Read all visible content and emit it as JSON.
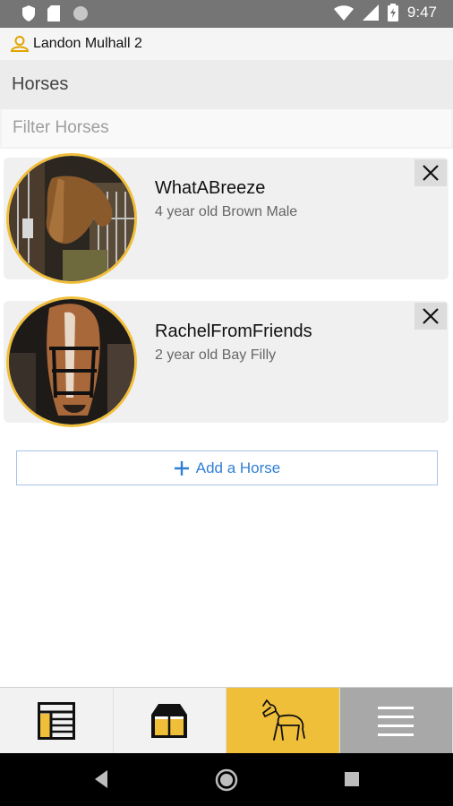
{
  "status_bar": {
    "time": "9:47",
    "icons": [
      "shield-icon",
      "sd-card-icon",
      "circle-icon",
      "wifi-icon",
      "signal-icon",
      "battery-icon"
    ]
  },
  "user": {
    "name": "Landon Mulhall 2",
    "icon": "person-icon"
  },
  "section": {
    "title": "Horses"
  },
  "filter": {
    "placeholder": "Filter Horses",
    "value": ""
  },
  "horses": [
    {
      "name": "WhatABreeze",
      "description": "4 year old Brown Male"
    },
    {
      "name": "RachelFromFriends",
      "description": "2 year old Bay Filly"
    }
  ],
  "add_button": {
    "label": "Add a Horse",
    "icon": "plus-icon"
  },
  "tabs": [
    {
      "icon": "dashboard-icon",
      "active": false
    },
    {
      "icon": "barn-icon",
      "active": false
    },
    {
      "icon": "horse-icon",
      "active": true
    },
    {
      "icon": "menu-icon",
      "active": false
    }
  ],
  "colors": {
    "accent": "#f0bf3a",
    "link": "#2f7fd6",
    "status_bar": "#757575",
    "menu_tab": "#a8a8a8"
  }
}
